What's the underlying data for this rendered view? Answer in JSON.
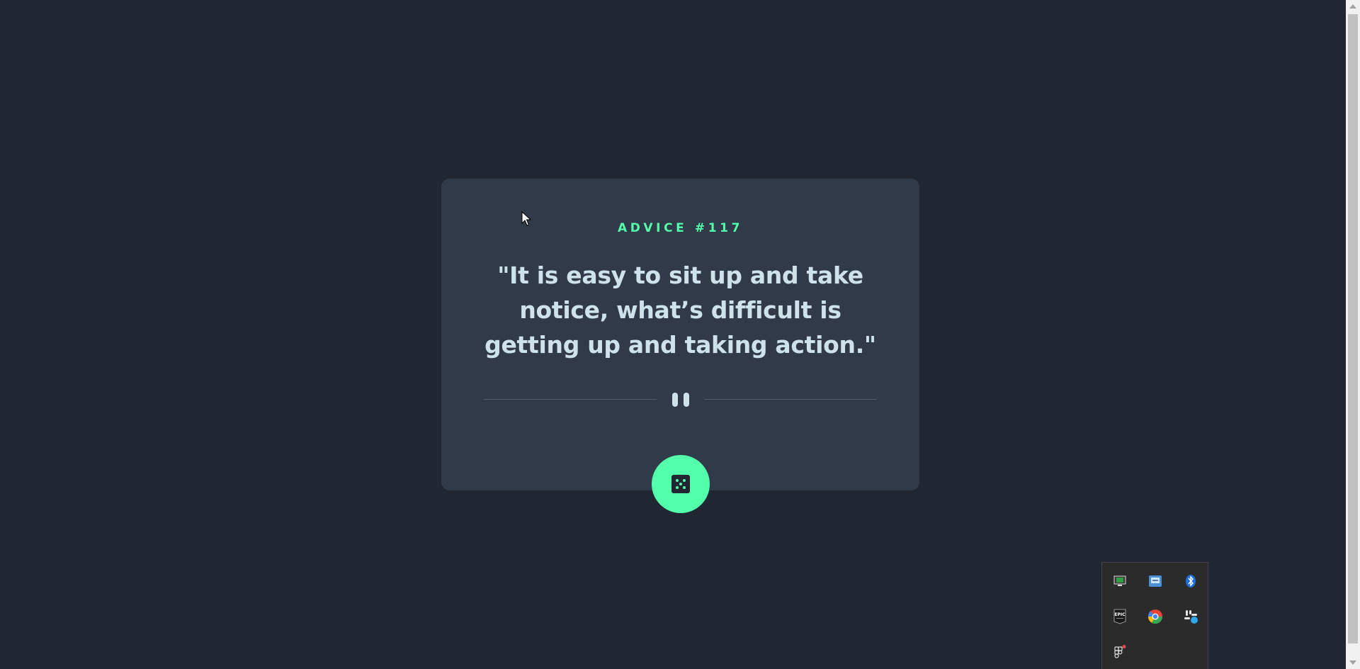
{
  "advice": {
    "id_label": "ADVICE #117",
    "text": "\"It is easy to sit up and take notice, what’s difficult is getting up and taking action.\""
  },
  "buttons": {
    "dice_icon": "dice-icon"
  },
  "tray": {
    "icons": [
      {
        "name": "monitor-app-icon"
      },
      {
        "name": "network-app-icon"
      },
      {
        "name": "bluetooth-icon"
      },
      {
        "name": "epic-games-icon",
        "label": "EPIC"
      },
      {
        "name": "chrome-like-icon"
      },
      {
        "name": "slack-icon"
      },
      {
        "name": "figma-icon"
      }
    ]
  },
  "colors": {
    "background": "#202632",
    "card": "#313a48",
    "accent": "#53ffaa",
    "text": "#cee3e9",
    "divider": "#4f5d74"
  }
}
